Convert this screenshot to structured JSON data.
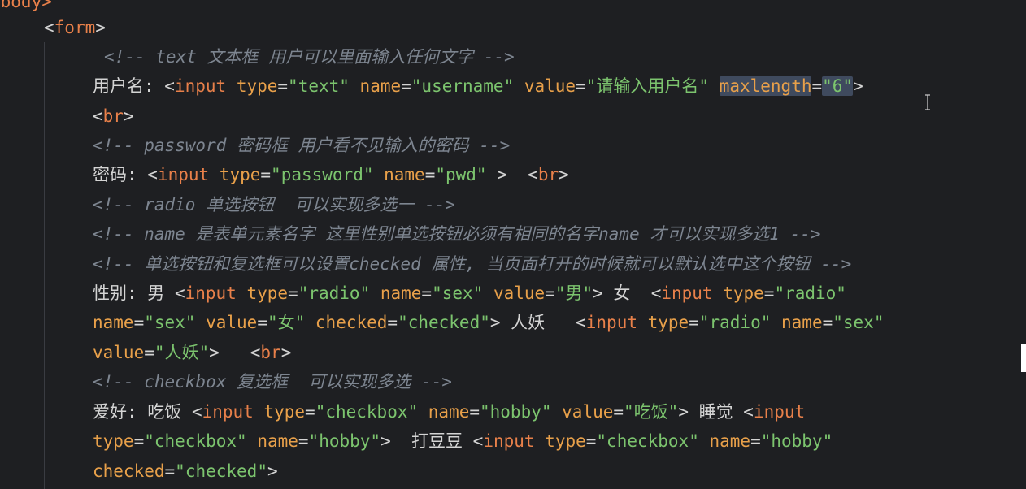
{
  "lines": [
    [
      {
        "t": "<body>",
        "c": "tag"
      }
    ],
    [
      {
        "t": "<",
        "c": "punct"
      },
      {
        "t": "form",
        "c": "tag"
      },
      {
        "t": ">",
        "c": "punct"
      }
    ],
    [
      {
        "t": "<!-- text 文本框 用户可以里面输入任何文字 -->",
        "c": "cmt"
      }
    ],
    [
      {
        "t": "用户名: ",
        "c": "txt"
      },
      {
        "t": "<",
        "c": "punct"
      },
      {
        "t": "input",
        "c": "tag"
      },
      {
        "t": " type",
        "c": "attr"
      },
      {
        "t": "=",
        "c": "punct"
      },
      {
        "t": "\"text\"",
        "c": "str"
      },
      {
        "t": " name",
        "c": "attr"
      },
      {
        "t": "=",
        "c": "punct"
      },
      {
        "t": "\"username\"",
        "c": "str"
      },
      {
        "t": " value",
        "c": "attr"
      },
      {
        "t": "=",
        "c": "punct"
      },
      {
        "t": "\"请输入用户名\"",
        "c": "str"
      },
      {
        "t": " ",
        "c": "punct"
      },
      {
        "t": "maxlength",
        "c": "attr hl"
      },
      {
        "t": "=",
        "c": "punct"
      },
      {
        "t": "\"6\"",
        "c": "str hl"
      },
      {
        "t": ">",
        "c": "punct"
      }
    ],
    [
      {
        "t": "<",
        "c": "punct"
      },
      {
        "t": "br",
        "c": "tag"
      },
      {
        "t": ">",
        "c": "punct"
      }
    ],
    [
      {
        "t": "<!-- password 密码框 用户看不见输入的密码 -->",
        "c": "cmt"
      }
    ],
    [
      {
        "t": "密码: ",
        "c": "txt"
      },
      {
        "t": "<",
        "c": "punct"
      },
      {
        "t": "input",
        "c": "tag"
      },
      {
        "t": " type",
        "c": "attr"
      },
      {
        "t": "=",
        "c": "punct"
      },
      {
        "t": "\"password\"",
        "c": "str"
      },
      {
        "t": " name",
        "c": "attr"
      },
      {
        "t": "=",
        "c": "punct"
      },
      {
        "t": "\"pwd\"",
        "c": "str"
      },
      {
        "t": " >  ",
        "c": "punct"
      },
      {
        "t": "<",
        "c": "punct"
      },
      {
        "t": "br",
        "c": "tag"
      },
      {
        "t": ">",
        "c": "punct"
      }
    ],
    [
      {
        "t": "<!-- radio 单选按钮  可以实现多选一 -->",
        "c": "cmt"
      }
    ],
    [
      {
        "t": "<!-- name 是表单元素名字 这里性别单选按钮必须有相同的名字name 才可以实现多选1 -->",
        "c": "cmt"
      }
    ],
    [
      {
        "t": "<!-- 单选按钮和复选框可以设置checked 属性, 当页面打开的时候就可以默认选中这个按钮 -->",
        "c": "cmt"
      }
    ],
    [
      {
        "t": "性别: 男 ",
        "c": "txt"
      },
      {
        "t": "<",
        "c": "punct"
      },
      {
        "t": "input",
        "c": "tag"
      },
      {
        "t": " type",
        "c": "attr"
      },
      {
        "t": "=",
        "c": "punct"
      },
      {
        "t": "\"radio\"",
        "c": "str"
      },
      {
        "t": " name",
        "c": "attr"
      },
      {
        "t": "=",
        "c": "punct"
      },
      {
        "t": "\"sex\"",
        "c": "str"
      },
      {
        "t": " value",
        "c": "attr"
      },
      {
        "t": "=",
        "c": "punct"
      },
      {
        "t": "\"男\"",
        "c": "str"
      },
      {
        "t": ">",
        "c": "punct"
      },
      {
        "t": " 女  ",
        "c": "txt"
      },
      {
        "t": "<",
        "c": "punct"
      },
      {
        "t": "input",
        "c": "tag"
      },
      {
        "t": " type",
        "c": "attr"
      },
      {
        "t": "=",
        "c": "punct"
      },
      {
        "t": "\"radio\"",
        "c": "str"
      }
    ],
    [
      {
        "t": "name",
        "c": "attr"
      },
      {
        "t": "=",
        "c": "punct"
      },
      {
        "t": "\"sex\"",
        "c": "str"
      },
      {
        "t": " value",
        "c": "attr"
      },
      {
        "t": "=",
        "c": "punct"
      },
      {
        "t": "\"女\"",
        "c": "str"
      },
      {
        "t": " checked",
        "c": "attr"
      },
      {
        "t": "=",
        "c": "punct"
      },
      {
        "t": "\"checked\"",
        "c": "str"
      },
      {
        "t": ">",
        "c": "punct"
      },
      {
        "t": " 人妖   ",
        "c": "txt"
      },
      {
        "t": "<",
        "c": "punct"
      },
      {
        "t": "input",
        "c": "tag"
      },
      {
        "t": " type",
        "c": "attr"
      },
      {
        "t": "=",
        "c": "punct"
      },
      {
        "t": "\"radio\"",
        "c": "str"
      },
      {
        "t": " name",
        "c": "attr"
      },
      {
        "t": "=",
        "c": "punct"
      },
      {
        "t": "\"sex\"",
        "c": "str"
      }
    ],
    [
      {
        "t": "value",
        "c": "attr"
      },
      {
        "t": "=",
        "c": "punct"
      },
      {
        "t": "\"人妖\"",
        "c": "str"
      },
      {
        "t": ">   ",
        "c": "punct"
      },
      {
        "t": "<",
        "c": "punct"
      },
      {
        "t": "br",
        "c": "tag"
      },
      {
        "t": ">",
        "c": "punct"
      }
    ],
    [
      {
        "t": "<!-- checkbox 复选框  可以实现多选 -->",
        "c": "cmt"
      }
    ],
    [
      {
        "t": "爱好: 吃饭 ",
        "c": "txt"
      },
      {
        "t": "<",
        "c": "punct"
      },
      {
        "t": "input",
        "c": "tag"
      },
      {
        "t": " type",
        "c": "attr"
      },
      {
        "t": "=",
        "c": "punct"
      },
      {
        "t": "\"checkbox\"",
        "c": "str"
      },
      {
        "t": " name",
        "c": "attr"
      },
      {
        "t": "=",
        "c": "punct"
      },
      {
        "t": "\"hobby\"",
        "c": "str"
      },
      {
        "t": " value",
        "c": "attr"
      },
      {
        "t": "=",
        "c": "punct"
      },
      {
        "t": "\"吃饭\"",
        "c": "str"
      },
      {
        "t": ">",
        "c": "punct"
      },
      {
        "t": " 睡觉 ",
        "c": "txt"
      },
      {
        "t": "<",
        "c": "punct"
      },
      {
        "t": "input",
        "c": "tag"
      }
    ],
    [
      {
        "t": "type",
        "c": "attr"
      },
      {
        "t": "=",
        "c": "punct"
      },
      {
        "t": "\"checkbox\"",
        "c": "str"
      },
      {
        "t": " name",
        "c": "attr"
      },
      {
        "t": "=",
        "c": "punct"
      },
      {
        "t": "\"hobby\"",
        "c": "str"
      },
      {
        "t": ">",
        "c": "punct"
      },
      {
        "t": "  打豆豆 ",
        "c": "txt"
      },
      {
        "t": "<",
        "c": "punct"
      },
      {
        "t": "input",
        "c": "tag"
      },
      {
        "t": " type",
        "c": "attr"
      },
      {
        "t": "=",
        "c": "punct"
      },
      {
        "t": "\"checkbox\"",
        "c": "str"
      },
      {
        "t": " name",
        "c": "attr"
      },
      {
        "t": "=",
        "c": "punct"
      },
      {
        "t": "\"hobby\"",
        "c": "str"
      }
    ],
    [
      {
        "t": "checked",
        "c": "attr"
      },
      {
        "t": "=",
        "c": "punct"
      },
      {
        "t": "\"checked\"",
        "c": "str"
      },
      {
        "t": ">",
        "c": "punct"
      }
    ]
  ],
  "colors": {
    "background": "#1e1f22",
    "tag": "#e8804a",
    "attribute": "#e8a04a",
    "string": "#7cc46e",
    "comment": "#7d8590",
    "text": "#d4d4d4",
    "selection": "#3f4a5e"
  },
  "icons": {
    "cursor": "text-cursor-icon"
  }
}
